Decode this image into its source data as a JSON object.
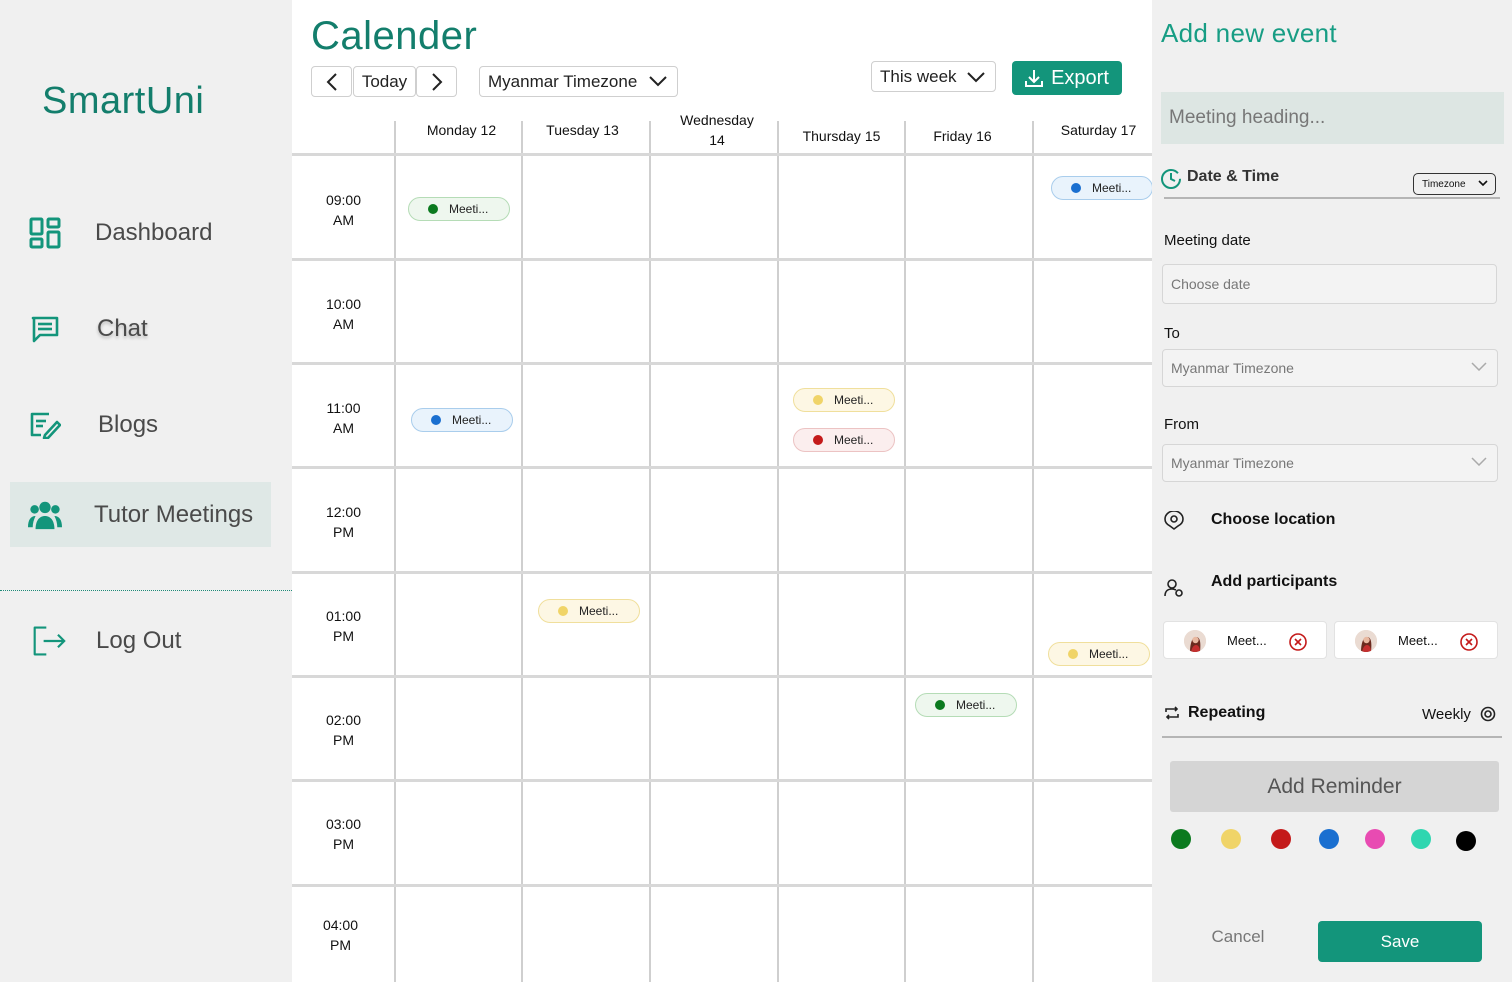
{
  "sidebar": {
    "brand": "SmartUni",
    "items": [
      {
        "label": "Dashboard",
        "icon": "dashboard-grid-icon"
      },
      {
        "label": "Chat",
        "icon": "chat-icon"
      },
      {
        "label": "Blogs",
        "icon": "blog-edit-icon"
      },
      {
        "label": "Tutor Meetings",
        "icon": "users-group-icon",
        "active": true
      },
      {
        "label": "Log Out",
        "icon": "logout-icon"
      }
    ]
  },
  "calendar": {
    "title": "Calender",
    "today_label": "Today",
    "timezone": "Myanmar Timezone",
    "range": "This week",
    "export_label": "Export",
    "days": [
      "Monday 12",
      "Tuesday 13",
      "Wednesday 14",
      "Thursday 15",
      "Friday 16",
      "Saturday 17"
    ],
    "times": [
      {
        "time": "09:00",
        "period": "AM"
      },
      {
        "time": "10:00",
        "period": "AM"
      },
      {
        "time": "11:00",
        "period": "AM"
      },
      {
        "time": "12:00",
        "period": "PM"
      },
      {
        "time": "01:00",
        "period": "PM"
      },
      {
        "time": "02:00",
        "period": "PM"
      },
      {
        "time": "03:00",
        "period": "PM"
      },
      {
        "time": "04:00",
        "period": "PM"
      }
    ],
    "events": [
      {
        "label": "Meeti...",
        "day": "Monday 12",
        "time": "09:00 AM",
        "color": "#0b7a1f"
      },
      {
        "label": "Meeti...",
        "day": "Saturday 17",
        "time": "09:00 AM",
        "color": "#1a6fd0"
      },
      {
        "label": "Meeti...",
        "day": "Monday 12",
        "time": "11:00 AM",
        "color": "#1a6fd0"
      },
      {
        "label": "Meeti...",
        "day": "Thursday 15",
        "time": "11:00 AM",
        "color": "#f0d468"
      },
      {
        "label": "Meeti...",
        "day": "Thursday 15",
        "time": "11:00 AM",
        "color": "#c41a1a"
      },
      {
        "label": "Meeti...",
        "day": "Tuesday 13",
        "time": "01:00 PM",
        "color": "#f0d468"
      },
      {
        "label": "Meeti...",
        "day": "Saturday 17",
        "time": "01:00 PM",
        "color": "#f0d468"
      },
      {
        "label": "Meeti...",
        "day": "Friday 16",
        "time": "02:00 PM",
        "color": "#0b7a1f"
      }
    ]
  },
  "panel": {
    "title": "Add new event",
    "heading_placeholder": "Meeting heading...",
    "date_time_label": "Date & Time",
    "timezone_pill": "Timezone",
    "meeting_date_label": "Meeting date",
    "date_placeholder": "Choose date",
    "to_label": "To",
    "to_value": "Myanmar Timezone",
    "from_label": "From",
    "from_value": "Myanmar Timezone",
    "location_label": "Choose location",
    "participants_label": "Add participants",
    "participants": [
      {
        "name": "Meet..."
      },
      {
        "name": "Meet..."
      }
    ],
    "repeating_label": "Repeating",
    "repeating_value": "Weekly",
    "reminder_label": "Add Reminder",
    "colors": [
      "#0b7a1f",
      "#f0d468",
      "#c41a1a",
      "#1a6fd0",
      "#e84bb2",
      "#2fd6b0",
      "#000000"
    ],
    "cancel_label": "Cancel",
    "save_label": "Save"
  }
}
